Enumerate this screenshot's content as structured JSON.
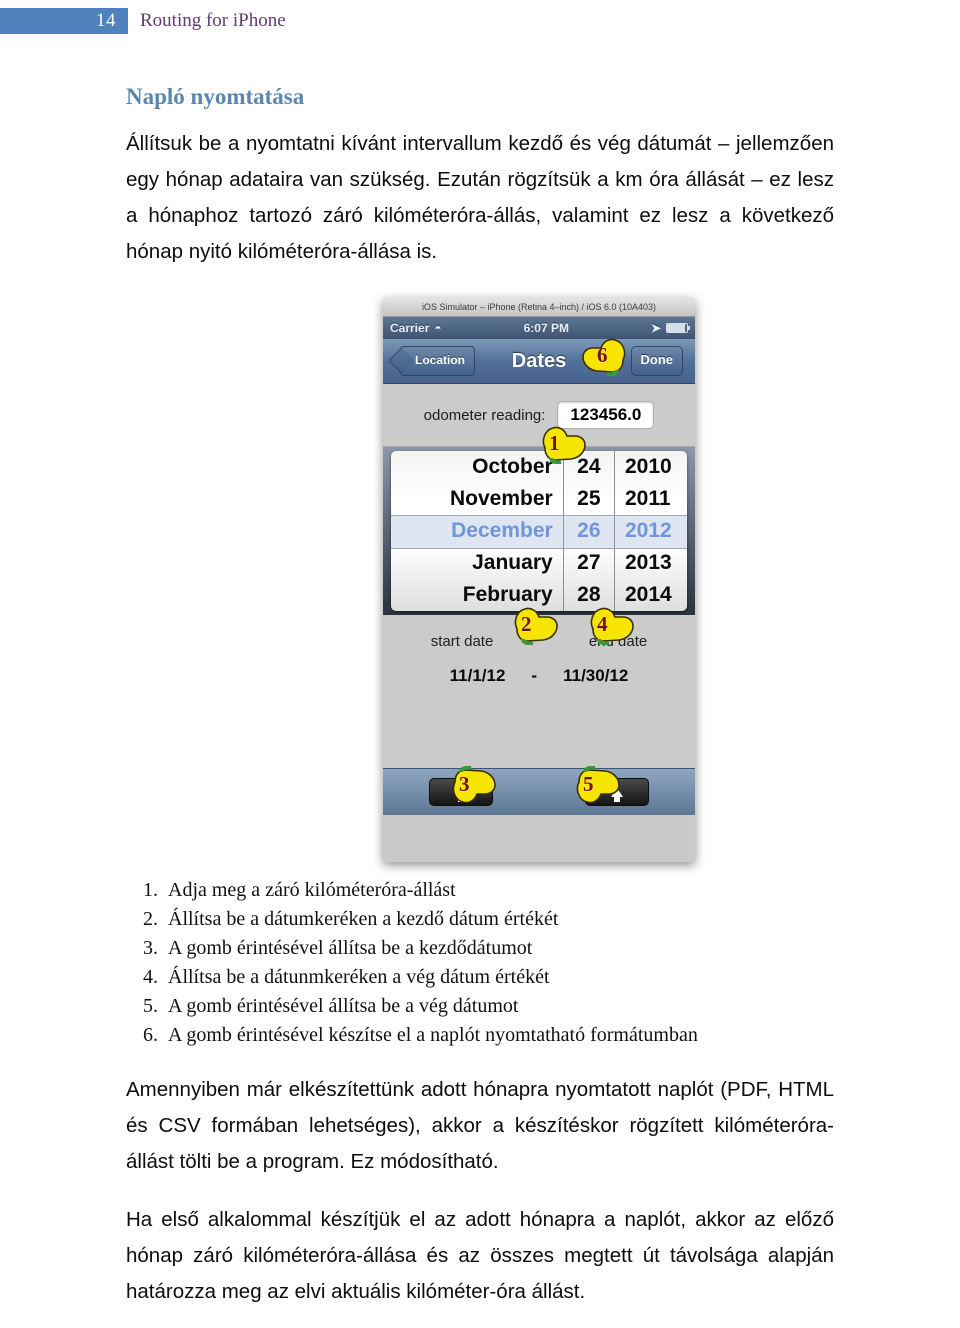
{
  "header": {
    "page_number": "14",
    "title": "Routing for iPhone",
    "badge_color": "#4f81bd",
    "title_color": "#5f3a72"
  },
  "section": {
    "heading": "Napló nyomtatása",
    "heading_color": "#5a87ad"
  },
  "intro_paragraph": "Állítsuk be a nyomtatni kívánt intervallum kezdő és vég dátumát – jellemzően egy hónap adataira van szükség. Ezután rögzítsük a km óra állását – ez lesz a hónaphoz tartozó záró kilóméteróra-állás, valamint ez lesz a következő hónap nyitó kilóméteróra-állása is.",
  "screenshot": {
    "simulator_title": "iOS Simulator – iPhone (Retina 4–inch) / iOS 6.0 (10A403)",
    "status_bar": {
      "carrier": "Carrier",
      "wifi_icon": "wifi-icon",
      "time": "6:07 PM",
      "location_icon": "location-arrow-icon",
      "battery_icon": "battery-icon"
    },
    "nav_bar": {
      "back_label": "Location",
      "title": "Dates",
      "done_label": "Done"
    },
    "odometer": {
      "label": "odometer reading:",
      "value": "123456.0"
    },
    "picker": {
      "months": [
        "October",
        "November",
        "December",
        "January",
        "February"
      ],
      "days": [
        "24",
        "25",
        "26",
        "27",
        "28"
      ],
      "years": [
        "2010",
        "2011",
        "2012",
        "2013",
        "2014"
      ],
      "selected_index": 2,
      "selected_month": "December",
      "selected_day": "26",
      "selected_year": "2012",
      "selected_color": "#5f8fe0"
    },
    "dates": {
      "start_label": "start date",
      "end_label": "end date",
      "start_value": "11/1/12",
      "separator": "-",
      "end_value": "11/30/12"
    },
    "toolbar": {
      "left_button_icon": "arrow-up-icon",
      "right_button_icon": "arrow-up-icon"
    },
    "callouts": [
      {
        "number": "1",
        "target": "odometer-field"
      },
      {
        "number": "2",
        "target": "start-date-wheel"
      },
      {
        "number": "3",
        "target": "set-start-date-button"
      },
      {
        "number": "4",
        "target": "end-date-wheel"
      },
      {
        "number": "5",
        "target": "set-end-date-button"
      },
      {
        "number": "6",
        "target": "done-button"
      }
    ]
  },
  "steps": [
    {
      "n": "1.",
      "text": "Adja meg a záró kilóméteróra-állást"
    },
    {
      "n": "2.",
      "text": "Állítsa be a dátumkeréken a kezdő dátum értékét"
    },
    {
      "n": "3.",
      "text": "A gomb érintésével állítsa be a kezdődátumot"
    },
    {
      "n": "4.",
      "text": "Állítsa be a dátunmkeréken a vég dátum értékét"
    },
    {
      "n": "5.",
      "text": "A gomb érintésével állítsa be a vég dátumot"
    },
    {
      "n": "6.",
      "text": "A gomb érintésével készítse el a naplót nyomtatható formátumban"
    }
  ],
  "paragraph_2": "Amennyiben már elkészítettünk adott hónapra nyomtatott naplót (PDF, HTML és CSV formában lehetséges), akkor a készítéskor rögzített kilóméteróra-állást tölti be a program. Ez módosítható.",
  "paragraph_3": "Ha első alkalommal készítjük el az adott hónapra a naplót, akkor az előző hónap záró kilóméteróra-állása és az összes megtett út távolsága alapján határozza meg az elvi aktuális kilóméter-óra állást."
}
